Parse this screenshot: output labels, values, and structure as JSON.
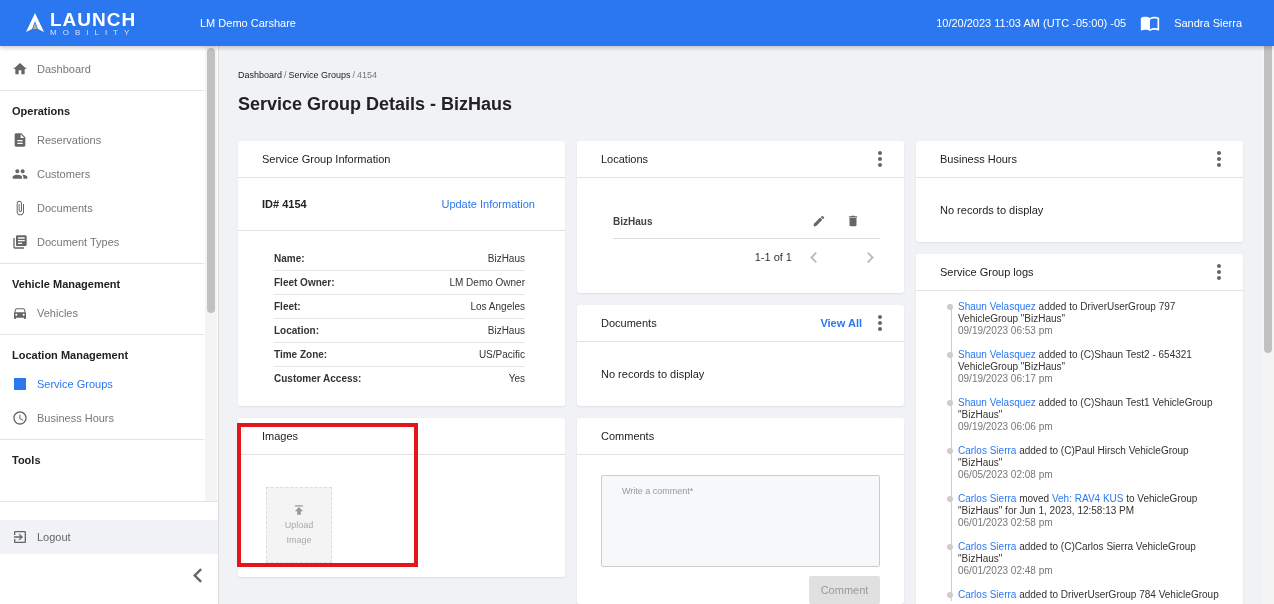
{
  "header": {
    "brand_top": "LAUNCH",
    "brand_bottom": "MOBILITY",
    "org": "LM Demo Carshare",
    "datetime": "10/20/2023 11:03 AM (UTC -05:00) -05",
    "user": "Sandra Sierra"
  },
  "sidebar": {
    "groups": [
      {
        "items": [
          {
            "label": "Dashboard",
            "selected": false
          }
        ]
      },
      {
        "title": "Operations",
        "items": [
          {
            "label": "Reservations",
            "selected": false
          },
          {
            "label": "Customers",
            "selected": false
          },
          {
            "label": "Documents",
            "selected": false
          },
          {
            "label": "Document Types",
            "selected": false
          }
        ]
      },
      {
        "title": "Vehicle Management",
        "items": [
          {
            "label": "Vehicles",
            "selected": false
          }
        ]
      },
      {
        "title": "Location Management",
        "items": [
          {
            "label": "Service Groups",
            "selected": true
          },
          {
            "label": "Business Hours",
            "selected": false
          }
        ]
      },
      {
        "title": "Tools"
      }
    ],
    "logout": "Logout"
  },
  "breadcrumb": {
    "separator": "/",
    "items": [
      {
        "label": "Dashboard",
        "current": false
      },
      {
        "label": "Service Groups",
        "current": false
      },
      {
        "label": "4154",
        "current": true
      }
    ]
  },
  "page_title": "Service Group Details - BizHaus",
  "info": {
    "title": "Service Group Information",
    "id": "ID# 4154",
    "action": "Update Information",
    "rows": [
      {
        "label": "Name:",
        "value": "BizHaus"
      },
      {
        "label": "Fleet Owner:",
        "value": "LM Demo Owner"
      },
      {
        "label": "Fleet:",
        "value": "Los Angeles"
      },
      {
        "label": "Location:",
        "value": "BizHaus"
      },
      {
        "label": "Time Zone:",
        "value": "US/Pacific"
      },
      {
        "label": "Customer Access:",
        "value": "Yes"
      }
    ]
  },
  "images": {
    "title": "Images",
    "upload_lines": [
      "Upload",
      "Image"
    ],
    "highlighted": true
  },
  "locations": {
    "title": "Locations",
    "rows": [
      {
        "name": "BizHaus"
      }
    ],
    "pagination": "1-1 of 1"
  },
  "documents": {
    "title": "Documents",
    "action": "View All",
    "empty": "No records to display"
  },
  "comments": {
    "title": "Comments",
    "placeholder": "Write a comment*",
    "button": "Comment",
    "disabled": true
  },
  "business_hours": {
    "title": "Business Hours",
    "empty": "No records to display"
  },
  "logs": {
    "title": "Service Group logs",
    "entries": [
      {
        "parts": [
          {
            "text": "Shaun Velasquez",
            "link": true
          },
          {
            "text": " added to DriverUserGroup 797 VehicleGroup \"BizHaus\"",
            "link": false
          }
        ],
        "time": "09/19/2023 06:53 pm"
      },
      {
        "parts": [
          {
            "text": "Shaun Velasquez",
            "link": true
          },
          {
            "text": " added to (C)Shaun Test2 - 654321 VehicleGroup \"BizHaus\"",
            "link": false
          }
        ],
        "time": "09/19/2023 06:17 pm"
      },
      {
        "parts": [
          {
            "text": "Shaun Velasquez",
            "link": true
          },
          {
            "text": " added to (C)Shaun Test1 VehicleGroup \"BizHaus\"",
            "link": false
          }
        ],
        "time": "09/19/2023 06:06 pm"
      },
      {
        "parts": [
          {
            "text": "Carlos Sierra",
            "link": true
          },
          {
            "text": " added to (C)Paul Hirsch VehicleGroup \"BizHaus\"",
            "link": false
          }
        ],
        "time": "06/05/2023 02:08 pm"
      },
      {
        "parts": [
          {
            "text": "Carlos Sierra",
            "link": true
          },
          {
            "text": " moved ",
            "link": false
          },
          {
            "text": "Veh: RAV4 KUS",
            "link": true
          },
          {
            "text": " to VehicleGroup \"BizHaus\" for Jun 1, 2023, 12:58:13 PM",
            "link": false
          }
        ],
        "time": "06/01/2023 02:58 pm"
      },
      {
        "parts": [
          {
            "text": "Carlos Sierra",
            "link": true
          },
          {
            "text": " added to (C)Carlos Sierra VehicleGroup \"BizHaus\"",
            "link": false
          }
        ],
        "time": "06/01/2023 02:48 pm"
      },
      {
        "parts": [
          {
            "text": "Carlos Sierra",
            "link": true
          },
          {
            "text": " added to DriverUserGroup 784 VehicleGroup",
            "link": false
          }
        ]
      }
    ]
  }
}
